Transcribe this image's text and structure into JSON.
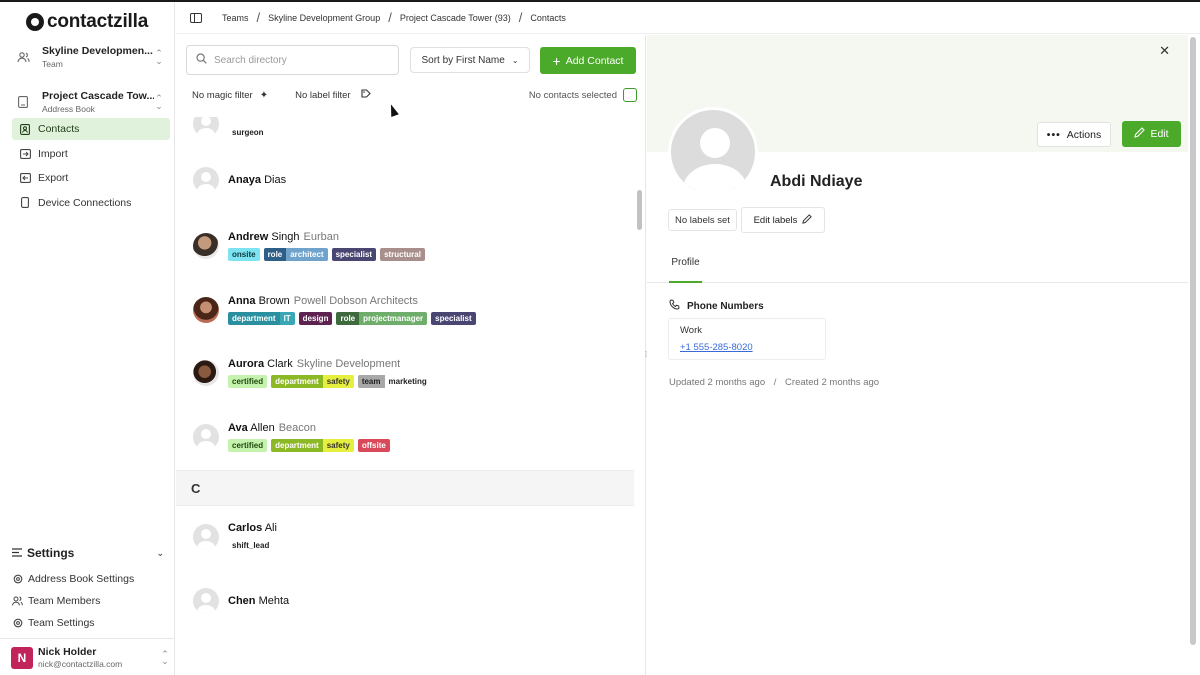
{
  "brand": {
    "logo_text": "contactzilla"
  },
  "team_switcher": {
    "title": "Skyline Developmen...",
    "subtitle": "Team"
  },
  "book_switcher": {
    "title": "Project Cascade Tow...",
    "subtitle": "Address Book"
  },
  "nav": [
    {
      "label": "Contacts",
      "icon": "contacts-icon",
      "active": true
    },
    {
      "label": "Import",
      "icon": "import-icon"
    },
    {
      "label": "Export",
      "icon": "export-icon"
    },
    {
      "label": "Device Connections",
      "icon": "device-icon"
    }
  ],
  "settings": {
    "heading": "Settings",
    "items": [
      {
        "label": "Address Book Settings",
        "icon": "settings-cog-icon"
      },
      {
        "label": "Team Members",
        "icon": "team-members-icon"
      },
      {
        "label": "Team Settings",
        "icon": "team-settings-icon"
      }
    ]
  },
  "user": {
    "initial": "N",
    "name": "Nick Holder",
    "email": "nick@contactzilla.com",
    "avatar_color": "#c0245a"
  },
  "breadcrumb": [
    "Teams",
    "Skyline Development Group",
    "Project Cascade Tower (93)",
    "Contacts"
  ],
  "toolbar": {
    "search_placeholder": "Search directory",
    "sort_label": "Sort by First Name",
    "add_label": "Add Contact",
    "magic_filter": "No magic filter",
    "label_filter": "No label filter",
    "selection": "No contacts selected"
  },
  "contacts": [
    {
      "first": "",
      "last": "",
      "org": "",
      "tags": [
        [
          {
            "t": "surgeon",
            "bg": "#ffffff",
            "fg": "#222"
          }
        ]
      ]
    },
    {
      "first": "Anaya",
      "last": "Dias",
      "org": "",
      "tags": []
    },
    {
      "first": "Andrew",
      "last": "Singh",
      "org": "Eurban",
      "tags": [
        [
          {
            "t": "onsite",
            "bg": "#7de3f0",
            "fg": "#0b3a40"
          }
        ],
        [
          {
            "t": "role",
            "bg": "#2f5f86",
            "fg": "#fff"
          },
          {
            "t": "architect",
            "bg": "#6fa3cc",
            "fg": "#fff"
          }
        ],
        [
          {
            "t": "specialist",
            "bg": "#4a4672",
            "fg": "#fff"
          }
        ],
        [
          {
            "t": "structural",
            "bg": "#a98f8c",
            "fg": "#fff"
          }
        ]
      ]
    },
    {
      "first": "Anna",
      "last": "Brown",
      "org": "Powell Dobson Architects",
      "tags": [
        [
          {
            "t": "department",
            "bg": "#2a8f9e",
            "fg": "#fff"
          },
          {
            "t": "IT",
            "bg": "#39a7b6",
            "fg": "#fff"
          }
        ],
        [
          {
            "t": "design",
            "bg": "#5d2250",
            "fg": "#fff"
          }
        ],
        [
          {
            "t": "role",
            "bg": "#3f6a3d",
            "fg": "#fff"
          },
          {
            "t": "projectmanager",
            "bg": "#6fae6a",
            "fg": "#fff"
          }
        ],
        [
          {
            "t": "specialist",
            "bg": "#4a4672",
            "fg": "#fff"
          }
        ]
      ]
    },
    {
      "first": "Aurora",
      "last": "Clark",
      "org": "Skyline Development",
      "tags": [
        [
          {
            "t": "certified",
            "bg": "#c5f3ae",
            "fg": "#1f4a10"
          }
        ],
        [
          {
            "t": "department",
            "bg": "#8db826",
            "fg": "#fff"
          },
          {
            "t": "safety",
            "bg": "#e6ef3d",
            "fg": "#333"
          }
        ],
        [
          {
            "t": "team",
            "bg": "#a8a8a8",
            "fg": "#222"
          },
          {
            "t": "marketing",
            "bg": "#ffffff",
            "fg": "#222"
          }
        ]
      ]
    },
    {
      "first": "Ava",
      "last": "Allen",
      "org": "Beacon",
      "tags": [
        [
          {
            "t": "certified",
            "bg": "#c5f3ae",
            "fg": "#1f4a10"
          }
        ],
        [
          {
            "t": "department",
            "bg": "#8db826",
            "fg": "#fff"
          },
          {
            "t": "safety",
            "bg": "#e6ef3d",
            "fg": "#333"
          }
        ],
        [
          {
            "t": "offsite",
            "bg": "#d9495a",
            "fg": "#fff"
          }
        ]
      ]
    },
    {
      "first": "Carlos",
      "last": "Ali",
      "org": "",
      "tags": [
        [
          {
            "t": "shift_lead",
            "bg": "#ffffff",
            "fg": "#222"
          }
        ]
      ]
    },
    {
      "first": "Chen",
      "last": "Mehta",
      "org": "",
      "tags": []
    }
  ],
  "section_letter": "C",
  "detail": {
    "name": "Abdi Ndiaye",
    "actions_label": "Actions",
    "edit_label": "Edit",
    "no_labels": "No labels set",
    "edit_labels": "Edit labels",
    "tab": "Profile",
    "phone_heading": "Phone Numbers",
    "phone_label": "Work",
    "phone_value": "+1 555-285-8020",
    "updated": "Updated 2 months ago",
    "created": "Created 2 months ago",
    "dates_sep": "/"
  },
  "colors": {
    "accent": "#4caa2a",
    "active_nav": "#e1f2dc"
  }
}
